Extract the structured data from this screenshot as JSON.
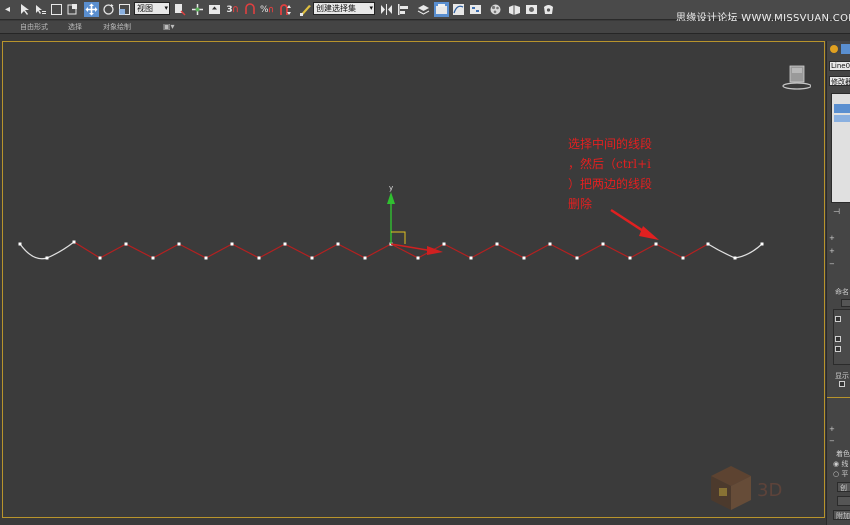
{
  "toolbar": {
    "view_dropdown": "视图",
    "selection_set_dropdown": "创建选择集",
    "snap_label": "3",
    "angle_snap_label": "∆",
    "percent_snap_label": "%"
  },
  "watermark": "思缘设计论坛 WWW.MISSVUAN.COM",
  "ribbon": {
    "item1": "自由形式",
    "item2": "选择",
    "item3": "对象绘制"
  },
  "viewport": {
    "gizmo_y_label": "y",
    "annotation_lines": [
      "选择中间的线段",
      "，然后（ctrl+i",
      "）把两边的线段",
      "删除"
    ]
  },
  "cmdpanel": {
    "object_name": "Line001",
    "modifier_list_label": "修改器",
    "rollout1": "命名",
    "rollout2": "显示",
    "rollout3": "着色",
    "radio1": "线",
    "radio2": "平",
    "button1": "创",
    "button2": "附加"
  },
  "colors": {
    "selected_segment": "#b52020",
    "unselected_segment": "#e0e0e0",
    "viewport_border": "#b8942c",
    "annotation": "#e22020",
    "active_button": "#5a8fd0"
  }
}
